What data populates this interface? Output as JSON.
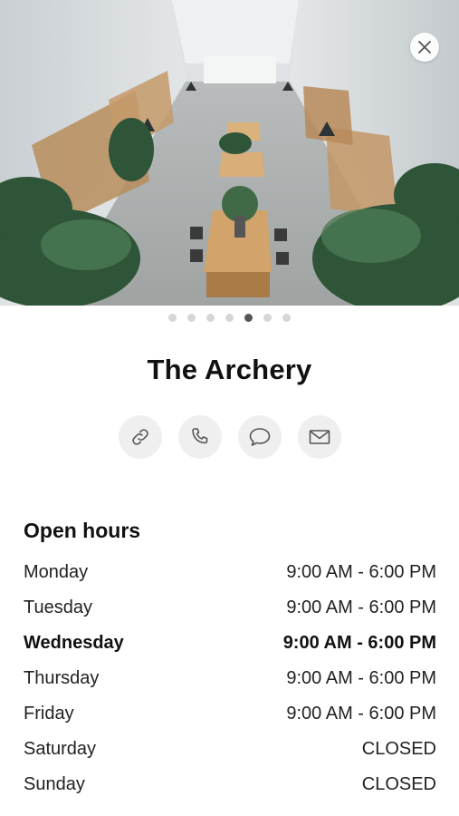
{
  "hero": {
    "photo": "office-interior-with-plants",
    "close_icon": "close-icon"
  },
  "carousel": {
    "count": 7,
    "active_index": 4
  },
  "place": {
    "name": "The Archery"
  },
  "actions": [
    {
      "icon": "link-icon"
    },
    {
      "icon": "phone-icon"
    },
    {
      "icon": "message-icon"
    },
    {
      "icon": "mail-icon"
    }
  ],
  "hours": {
    "title": "Open hours",
    "days": [
      {
        "day": "Monday",
        "time": "9:00 AM - 6:00 PM"
      },
      {
        "day": "Tuesday",
        "time": "9:00 AM - 6:00 PM"
      },
      {
        "day": "Wednesday",
        "time": "9:00 AM - 6:00 PM",
        "today": true
      },
      {
        "day": "Thursday",
        "time": "9:00 AM - 6:00 PM"
      },
      {
        "day": "Friday",
        "time": "9:00 AM - 6:00 PM"
      },
      {
        "day": "Saturday",
        "time": "CLOSED"
      },
      {
        "day": "Sunday",
        "time": "CLOSED"
      }
    ]
  }
}
